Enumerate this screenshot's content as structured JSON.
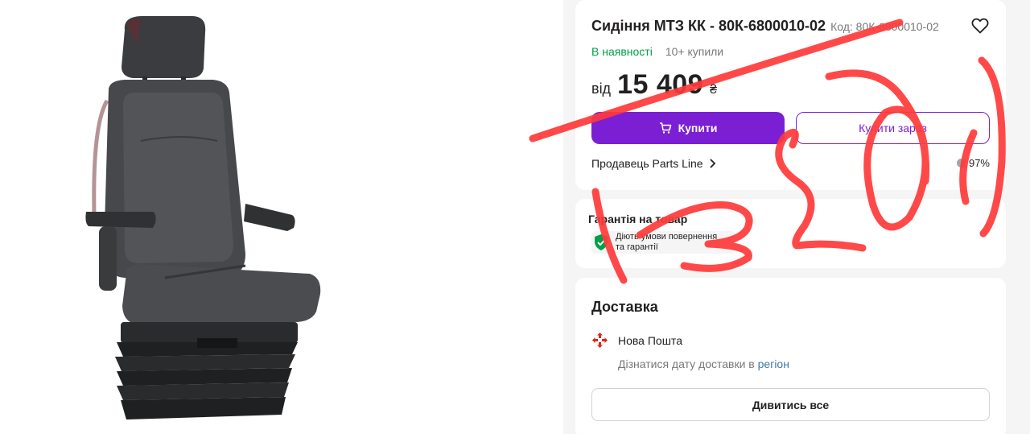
{
  "product": {
    "title": "Сидіння МТЗ КК - 80К-6800010-02",
    "code": "Код: 80К-6800010-02",
    "stock": "В наявності",
    "bought": "10+ купили",
    "price_from": "від",
    "price": "15 409",
    "currency": "₴"
  },
  "actions": {
    "buy_label": "Купити",
    "quick_buy_label": "Купити зараз"
  },
  "seller": {
    "label": "Продавець Parts Line",
    "rating": "97%"
  },
  "warranty": {
    "title": "Гарантія на товар",
    "line1": "Діють умови повернення",
    "line2": "та гарантії"
  },
  "delivery": {
    "title": "Доставка",
    "carrier": "Нова Пошта",
    "hint_text": "Дізнатися дату доставки в",
    "hint_link": "регіон",
    "view_all_label": "Дивитись все"
  },
  "colors": {
    "accent": "#7b1fd4",
    "in_stock": "#00a046",
    "annotation": "#ff3a3a",
    "np_logo": "#da291c"
  },
  "icons": {
    "favorite": "heart-icon",
    "cart": "cart-icon",
    "seller_chevron": "chevron-right-icon",
    "warranty": "shield-check-icon",
    "carrier": "nova-poshta-icon"
  }
}
